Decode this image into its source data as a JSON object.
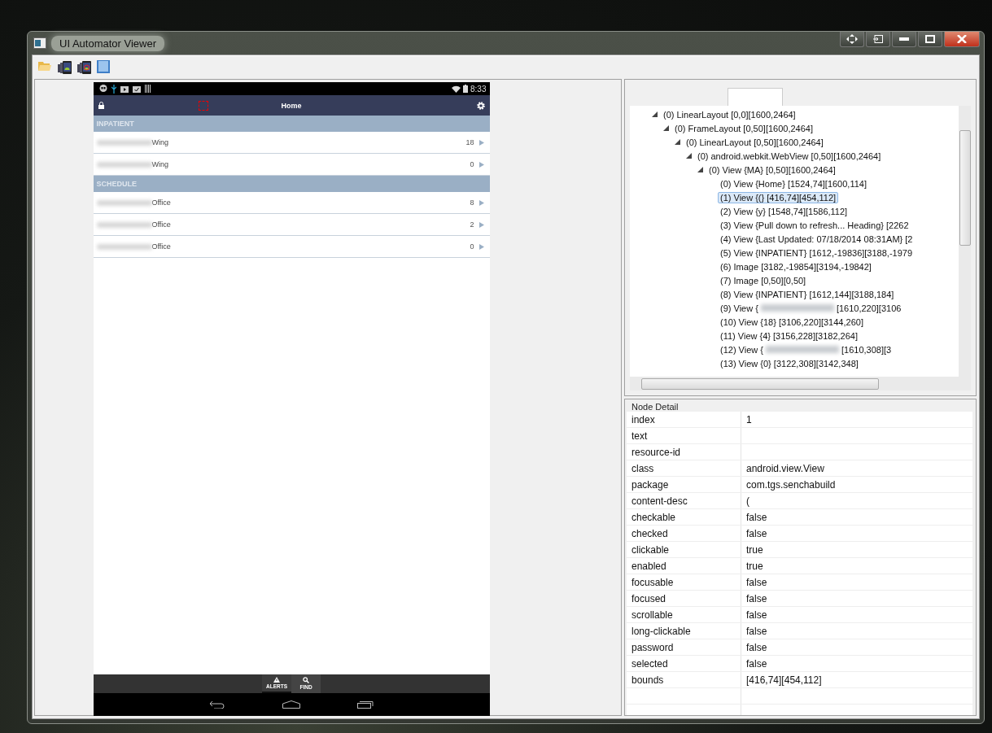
{
  "window": {
    "title": "UI Automator Viewer"
  },
  "device_screen": {
    "status_bar": {
      "time": "8:33"
    },
    "header": {
      "title": "Home"
    },
    "sections": [
      {
        "title": "INPATIENT",
        "rows": [
          {
            "label": "Wing",
            "blurred": true,
            "count": "18"
          },
          {
            "label": "Wing",
            "blurred": true,
            "count": "0"
          }
        ]
      },
      {
        "title": "SCHEDULE",
        "rows": [
          {
            "label": "Office",
            "blurred": true,
            "count": "8"
          },
          {
            "label": "Office",
            "blurred": true,
            "count": "2"
          },
          {
            "label": "Office",
            "blurred": true,
            "count": "0"
          }
        ]
      }
    ],
    "bottom_tabs": [
      {
        "label": "ALERTS",
        "kind": "alert",
        "selected": true
      },
      {
        "label": "FIND",
        "kind": "search",
        "selected": false
      }
    ]
  },
  "tree": {
    "nodes": [
      {
        "label": "(0) LinearLayout [0,0][1600,2464]",
        "selected": false,
        "expanded": true,
        "children": [
          {
            "label": "(0) FrameLayout [0,50][1600,2464]",
            "selected": false,
            "expanded": true,
            "children": [
              {
                "label": "(0) LinearLayout [0,50][1600,2464]",
                "selected": false,
                "expanded": true,
                "children": [
                  {
                    "label": "(0) android.webkit.WebView [0,50][1600,2464]",
                    "selected": false,
                    "expanded": true,
                    "children": [
                      {
                        "label": "(0) View {MA} [0,50][1600,2464]",
                        "selected": false,
                        "expanded": true,
                        "children": [
                          {
                            "label": "(0) View {Home} [1524,74][1600,114]",
                            "selected": false
                          },
                          {
                            "label": "(1) View {(} [416,74][454,112]",
                            "selected": true
                          },
                          {
                            "label": "(2) View {y} [1548,74][1586,112]",
                            "selected": false
                          },
                          {
                            "label": "(3) View {Pull down to refresh... Heading} [2262",
                            "selected": false
                          },
                          {
                            "label": "(4) View {Last Updated: 07/18/2014 08:31AM} [2",
                            "selected": false
                          },
                          {
                            "label": "(5) View {INPATIENT} [1612,-19836][3188,-1979",
                            "selected": false
                          },
                          {
                            "label": "(6) Image [3182,-19854][3194,-19842]",
                            "selected": false
                          },
                          {
                            "label": "(7) Image [0,50][0,50]",
                            "selected": false
                          },
                          {
                            "label": "(8) View {INPATIENT} [1612,144][3188,184]",
                            "selected": false
                          },
                          {
                            "label": "(9) View {",
                            "redacted": true,
                            "label_end": "[1610,220][3106",
                            "selected": false
                          },
                          {
                            "label": "(10) View {18} [3106,220][3144,260]",
                            "selected": false
                          },
                          {
                            "label": "(11) View {4} [3156,228][3182,264]",
                            "selected": false
                          },
                          {
                            "label": "(12) View {",
                            "redacted": true,
                            "label_end": "[1610,308][3",
                            "selected": false
                          },
                          {
                            "label": "(13) View {0} [3122,308][3142,348]",
                            "selected": false
                          }
                        ]
                      }
                    ]
                  }
                ]
              }
            ]
          }
        ]
      }
    ]
  },
  "node_detail": {
    "title": "Node Detail",
    "properties": [
      {
        "name": "index",
        "value": "1"
      },
      {
        "name": "text"
      },
      {
        "name": "resource-id"
      },
      {
        "name": "class",
        "value": "android.view.View"
      },
      {
        "name": "package",
        "value": "com.tgs.senchabuild"
      },
      {
        "name": "content-desc",
        "value": "("
      },
      {
        "name": "checkable",
        "value": "false"
      },
      {
        "name": "checked",
        "value": "false"
      },
      {
        "name": "clickable",
        "value": "true"
      },
      {
        "name": "enabled",
        "value": "true"
      },
      {
        "name": "focusable",
        "value": "false"
      },
      {
        "name": "focused",
        "value": "false"
      },
      {
        "name": "scrollable",
        "value": "false"
      },
      {
        "name": "long-clickable",
        "value": "false"
      },
      {
        "name": "password",
        "value": "false"
      },
      {
        "name": "selected",
        "value": "false"
      },
      {
        "name": "bounds",
        "value": "[416,74][454,112]"
      }
    ]
  }
}
